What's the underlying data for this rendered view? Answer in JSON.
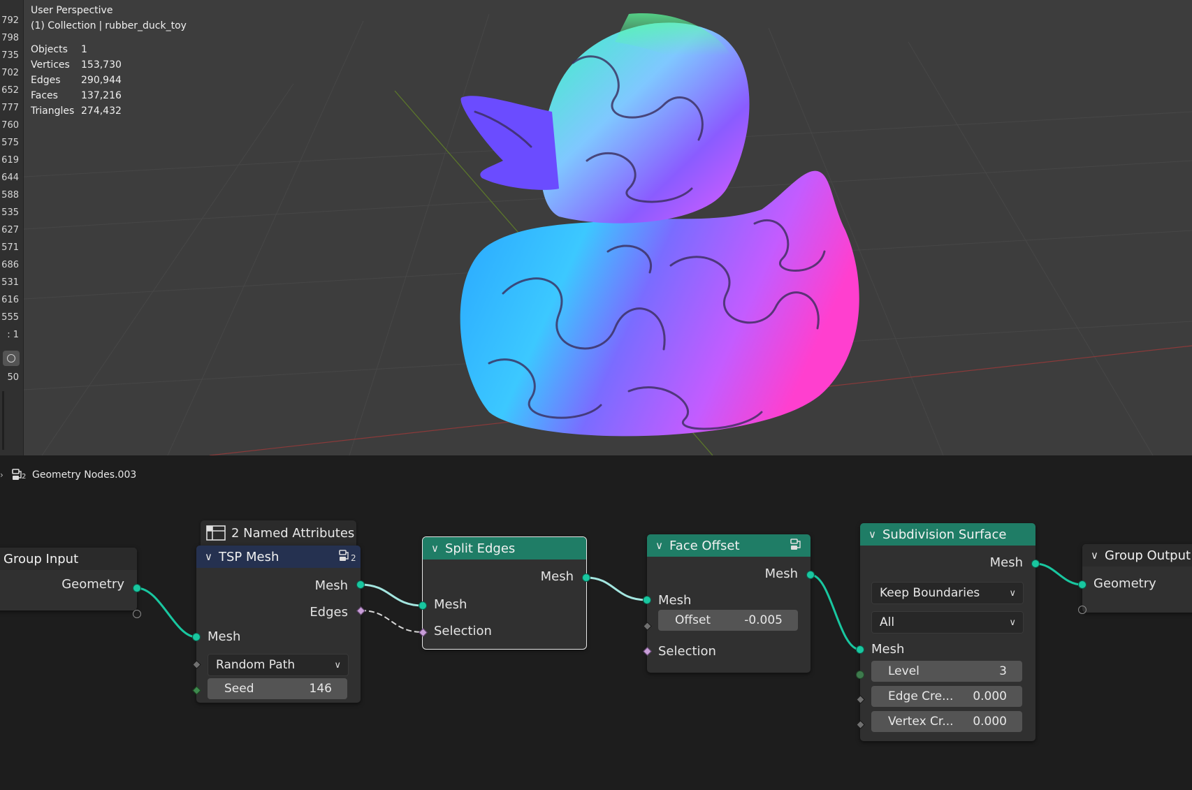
{
  "viewport": {
    "view_name": "User Perspective",
    "collection_prefix": "(1) Collection",
    "separator": "|",
    "object_name": "rubber_duck_toy",
    "stats": [
      {
        "label": "Objects",
        "value": "1"
      },
      {
        "label": "Vertices",
        "value": "153,730"
      },
      {
        "label": "Edges",
        "value": "290,944"
      },
      {
        "label": "Faces",
        "value": "137,216"
      },
      {
        "label": "Triangles",
        "value": "274,432"
      }
    ],
    "left_strip_numbers": [
      "792",
      "798",
      "735",
      "702",
      "652",
      "777",
      "760",
      "575",
      "619",
      "644",
      "588",
      "535",
      "627",
      "571",
      "686",
      "531",
      "616",
      "555",
      ": 1",
      "50"
    ]
  },
  "node_editor": {
    "tree_name": "Geometry Nodes.003",
    "tree_user_count": "2",
    "named_attributes_label": "2 Named Attributes",
    "nodes": {
      "group_input": {
        "title": "Group Input",
        "out_geometry": "Geometry"
      },
      "tsp_mesh": {
        "title": "TSP Mesh",
        "badge": "2",
        "out_mesh": "Mesh",
        "out_edges": "Edges",
        "in_mesh": "Mesh",
        "mode": "Random Path",
        "seed_label": "Seed",
        "seed_value": "146"
      },
      "split_edges": {
        "title": "Split Edges",
        "out_mesh": "Mesh",
        "in_mesh": "Mesh",
        "in_selection": "Selection"
      },
      "face_offset": {
        "title": "Face Offset",
        "out_mesh": "Mesh",
        "in_mesh": "Mesh",
        "offset_label": "Offset",
        "offset_value": "-0.005",
        "in_selection": "Selection"
      },
      "subdivision_surface": {
        "title": "Subdivision Surface",
        "out_mesh": "Mesh",
        "uv_smooth": "Keep Boundaries",
        "boundary_smooth": "All",
        "in_mesh": "Mesh",
        "level_label": "Level",
        "level_value": "3",
        "edge_crease_label": "Edge Cre...",
        "edge_crease_value": "0.000",
        "vertex_crease_label": "Vertex Cr...",
        "vertex_crease_value": "0.000"
      },
      "group_output": {
        "title": "Group Output",
        "in_geometry": "Geometry"
      }
    }
  },
  "colors": {
    "viewport_bg": "#3d3d3d",
    "node_editor_bg": "#1d1d1d",
    "geometry_socket": "#19c7a0",
    "header_green": "#1f7d66",
    "header_blue": "#253150"
  }
}
